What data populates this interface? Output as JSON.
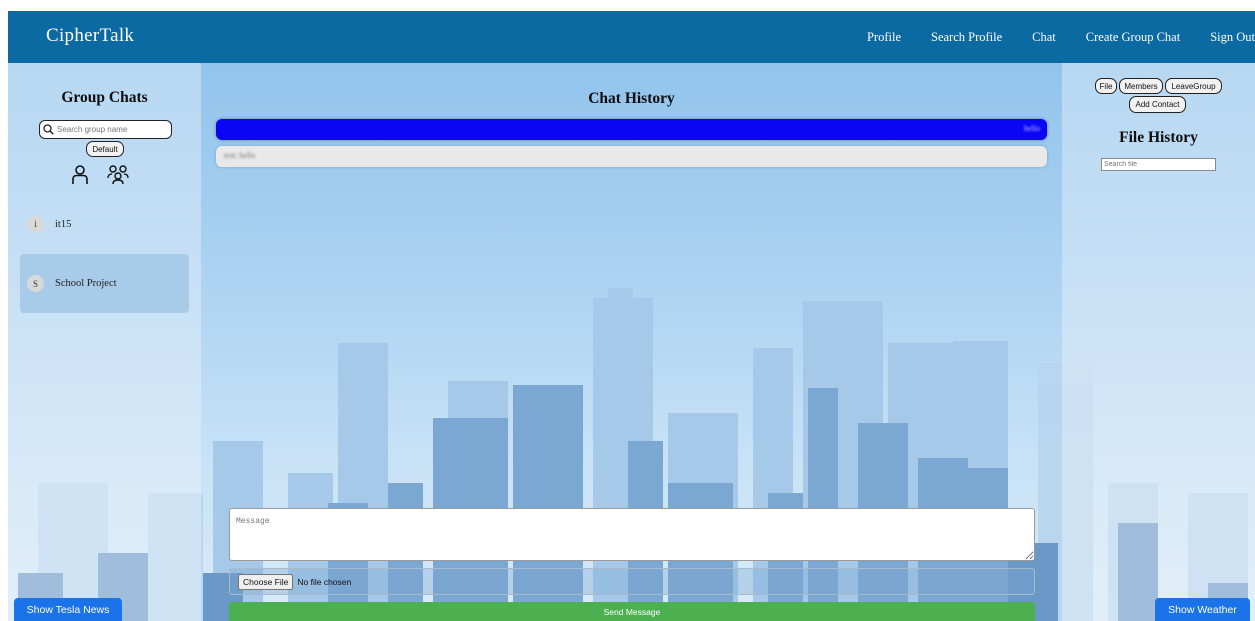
{
  "navbar": {
    "brand": "CipherTalk",
    "links": [
      "Profile",
      "Search Profile",
      "Chat",
      "Create Group Chat",
      "Sign Out"
    ]
  },
  "left_panel": {
    "title": "Group Chats",
    "search_placeholder": "Search group name",
    "default_button": "Default",
    "icons": [
      "person-icon",
      "group-icon"
    ],
    "chats": [
      {
        "avatar": "i",
        "name": "it15",
        "selected": false
      },
      {
        "avatar": "S",
        "name": "School Project",
        "selected": true
      }
    ]
  },
  "main": {
    "title": "Chat History",
    "messages": [
      {
        "direction": "sent",
        "text": "hello"
      },
      {
        "direction": "received",
        "text": "test: hello"
      }
    ],
    "message_placeholder": "Message",
    "file_button": "Choose File",
    "file_status": "No file chosen",
    "send_label": "Send Message"
  },
  "right_panel": {
    "buttons": [
      "File",
      "Members",
      "LeaveGroup",
      "Add Contact"
    ],
    "title": "File History",
    "search_placeholder": "Search file"
  },
  "floating": {
    "news_label": "Show Tesla News",
    "weather_label": "Show Weather"
  },
  "colors": {
    "navbar": "#0b6aa2",
    "sent_bubble": "#0a06f5",
    "send_button": "#4caf50",
    "floating_button": "#1a73e8"
  }
}
